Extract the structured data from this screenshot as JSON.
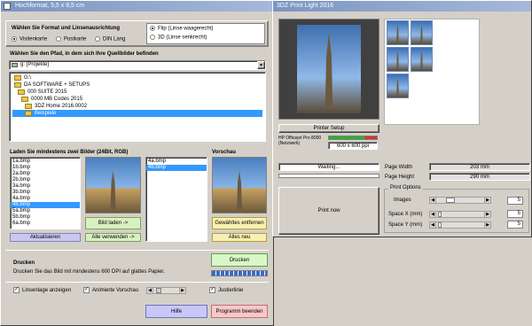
{
  "left_window": {
    "title": "Hochformat, 5,5 x 8,5 cm",
    "format_heading": "Wählen Sie Format und Linsenausrichtung",
    "formats": [
      "Visitenkarte",
      "Postkarte",
      "DIN Lang"
    ],
    "lens_options": [
      "Flip (Linse waagerecht)",
      "3D (Linse senkrecht)"
    ],
    "path_heading": "Wählen Sie den Pfad, in dem sich Ihre Quellbilder befinden",
    "drive_value": "g: [Projekte]",
    "tree": [
      "G:\\",
      "DA SOFTWARE + SETUPS",
      "000 SUITE 2015",
      "0000 MB Codes 2015",
      "3DZ Home 2016.0002",
      "Beispiele"
    ],
    "load_heading": "Laden Sie mindestens zwei Bilder (24Bit, RGB)",
    "preview_heading": "Vorschau",
    "source_files": [
      "1a.bmp",
      "1b.bmp",
      "2a.bmp",
      "2b.bmp",
      "3a.bmp",
      "3b.bmp",
      "4a.bmp",
      "4b.bmp",
      "5a.bmp",
      "5b.bmp",
      "6a.bmp"
    ],
    "selected_files": [
      "4a.bmp",
      "4b.bmp"
    ],
    "btn_refresh": "Aktualisieren",
    "btn_load": "Bild laden ->",
    "btn_use_all": "Alle verwenden ->",
    "btn_remove": "Gewähltes entfernen",
    "btn_new": "Alles neu",
    "print_heading": "Drucken",
    "print_text": "Drucken Sie das Bild mit mindestens 600 DPI auf glattes Papier.",
    "btn_print": "Drucken",
    "opt_lens_position": "Linsenlage anzeigen",
    "opt_animated_preview": "Animierte Vorschau",
    "opt_alignment_line": "Justierlinie",
    "btn_help": "Hilfe",
    "btn_exit": "Programm beenden"
  },
  "right_window": {
    "title": "3DZ Print Light 2016",
    "btn_printer_setup": "Printer Setup",
    "printer_name": "HP Officejet Pro 8000 (Netzwerk)",
    "resolution": "600 x 600 ppi",
    "status": "Waiting...",
    "btn_print_now": "Print now",
    "page_width_label": "Page Width",
    "page_width_value": "203 mm",
    "page_height_label": "Page Height",
    "page_height_value": "290 mm",
    "print_options_heading": "Print Options",
    "images_label": "Images",
    "images_value": "5",
    "space_x_label": "Space X (mm)",
    "space_x_value": "5",
    "space_y_label": "Space Y (mm)",
    "space_y_value": "5"
  }
}
